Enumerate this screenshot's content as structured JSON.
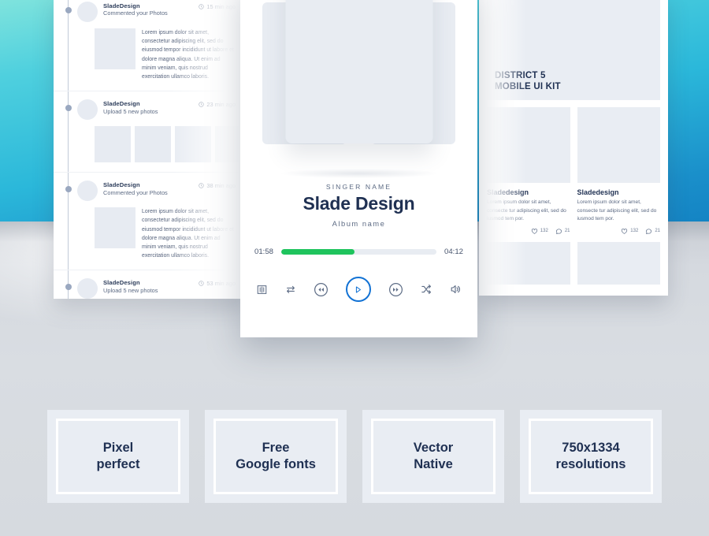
{
  "background": {
    "gradient_from": "#7fe3dd",
    "gradient_to": "#1484c4",
    "lower_color": "#d6dae0"
  },
  "feed_panel": {
    "items": [
      {
        "user": "SladeDesign",
        "action": "Commented your Photos",
        "time": "15 min ago",
        "type": "text",
        "body": "Lorem ipsum dolor sit amet, consectetur adipiscing elit, sed do eiusmod tempor incididunt ut labore et dolore magna aliqua. Ut enim ad minim veniam, quis nostrud exercitation ullamco laboris."
      },
      {
        "user": "SladeDesign",
        "action": "Upload 5 new photos",
        "time": "23 min ago",
        "type": "photos",
        "photo_count": 5
      },
      {
        "user": "SladeDesign",
        "action": "Commented your Photos",
        "time": "38 min ago",
        "type": "text",
        "body": "Lorem ipsum dolor sit amet, consectetur adipiscing elit, sed do eiusmod tempor incididunt ut labore et dolore magna aliqua. Ut enim ad minim veniam, quis nostrud exercitation ullamco laboris."
      },
      {
        "user": "SladeDesign",
        "action": "Upload 5 new photos",
        "time": "53 min ago",
        "type": "photos",
        "photo_count": 5
      }
    ]
  },
  "kit_panel": {
    "hero_title": "DISTRICT 5\nMOBILE UI KIT",
    "cards": [
      {
        "name": "Sladedesign",
        "text": "Lorem ipsum dolor sit amet, consecte tur adipiscing elit, sed do iusmod tem por.",
        "likes": "132",
        "comments": "21"
      },
      {
        "name": "Sladedesign",
        "text": "Lorem ipsum dolor sit amet, consecte tur adipiscing elit, sed do iusmod tem por.",
        "likes": "132",
        "comments": "21"
      }
    ]
  },
  "player": {
    "singer_label": "SINGER NAME",
    "track_title": "Slade Design",
    "album_label": "Album name",
    "time_elapsed": "01:58",
    "time_total": "04:12",
    "progress_percent": 47,
    "progress_color": "#1fc45d",
    "accent_color": "#1272d4",
    "controls": [
      "equalizer-icon",
      "repeat-icon",
      "rewind-icon",
      "play-icon",
      "fast-forward-icon",
      "shuffle-icon",
      "volume-icon"
    ]
  },
  "features": [
    {
      "label": "Pixel\nperfect"
    },
    {
      "label": "Free\nGoogle fonts"
    },
    {
      "label": "Vector\nNative"
    },
    {
      "label": "750x1334\nresolutions"
    }
  ]
}
